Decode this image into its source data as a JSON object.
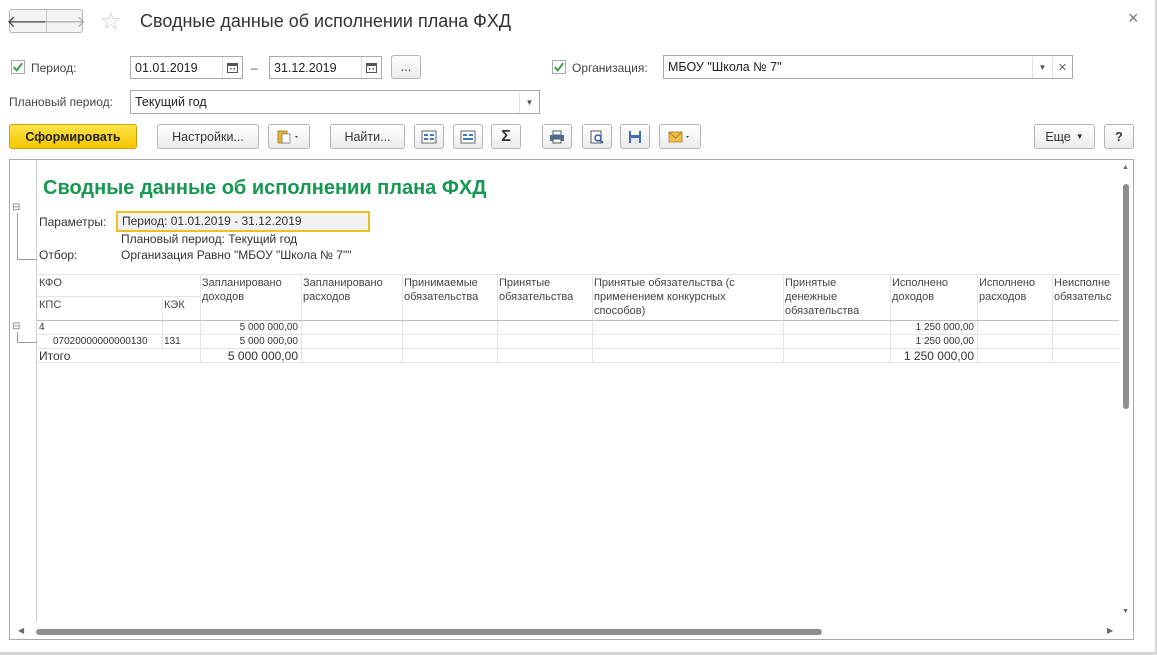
{
  "window": {
    "title": "Сводные данные об исполнении плана ФХД",
    "nav_back": "🡐",
    "nav_forward": "🡒",
    "star_icon": "☆",
    "close_icon": "×"
  },
  "filters": {
    "period_label": "Период:",
    "period_checked": true,
    "date_from": "01.01.2019",
    "dash": "–",
    "date_to": "31.12.2019",
    "period_more_label": "...",
    "org_label": "Организация:",
    "org_checked": true,
    "org_value": "МБОУ \"Школа № 7\"",
    "plan_period_label": "Плановый период:",
    "plan_period_value": "Текущий год"
  },
  "toolbar": {
    "generate_label": "Сформировать",
    "settings_label": "Настройки...",
    "find_label": "Найти...",
    "sum_label": "Σ",
    "more_label": "Еще",
    "help_label": "?"
  },
  "report": {
    "title": "Сводные данные об исполнении плана ФХД",
    "params_label": "Параметры:",
    "params_period": "Период: 01.01.2019 - 31.12.2019",
    "params_plan": "Плановый период: Текущий год",
    "filter_label": "Отбор:",
    "filter_value": "Организация Равно \"МБОУ \"Школа № 7\"\"",
    "headers": {
      "kfo": "КФО",
      "kps": "КПС",
      "kek": "КЭК",
      "planned_income": "Запланировано доходов",
      "planned_expense": "Запланировано расходов",
      "accepted_obligations": "Принимаемые обязательства",
      "taken_obligations": "Принятые обязательства",
      "taken_competitive": "Принятые обязательства (с применением конкурсных способов)",
      "taken_monetary": "Принятые денежные обязательства",
      "executed_income": "Исполнено доходов",
      "executed_expense": "Исполнено расходов",
      "unexecuted": "Неисполне обязательс"
    },
    "rows": [
      {
        "kfo": "4",
        "kps": "",
        "kek": "",
        "planned_income": "5 000 000,00",
        "executed_income": "1 250 000,00"
      },
      {
        "kfo": "",
        "kps": "07020000000000130",
        "kek": "131",
        "planned_income": "5 000 000,00",
        "executed_income": "1 250 000,00"
      }
    ],
    "total": {
      "label": "Итого",
      "planned_income": "5 000 000,00",
      "executed_income": "1 250 000,00"
    },
    "collapse_icon": "⊟"
  },
  "colors": {
    "title_green": "#159850",
    "primary_yellow": "#f5c700",
    "highlight_border": "#f0c020",
    "check_green": "#2e9e3e"
  }
}
